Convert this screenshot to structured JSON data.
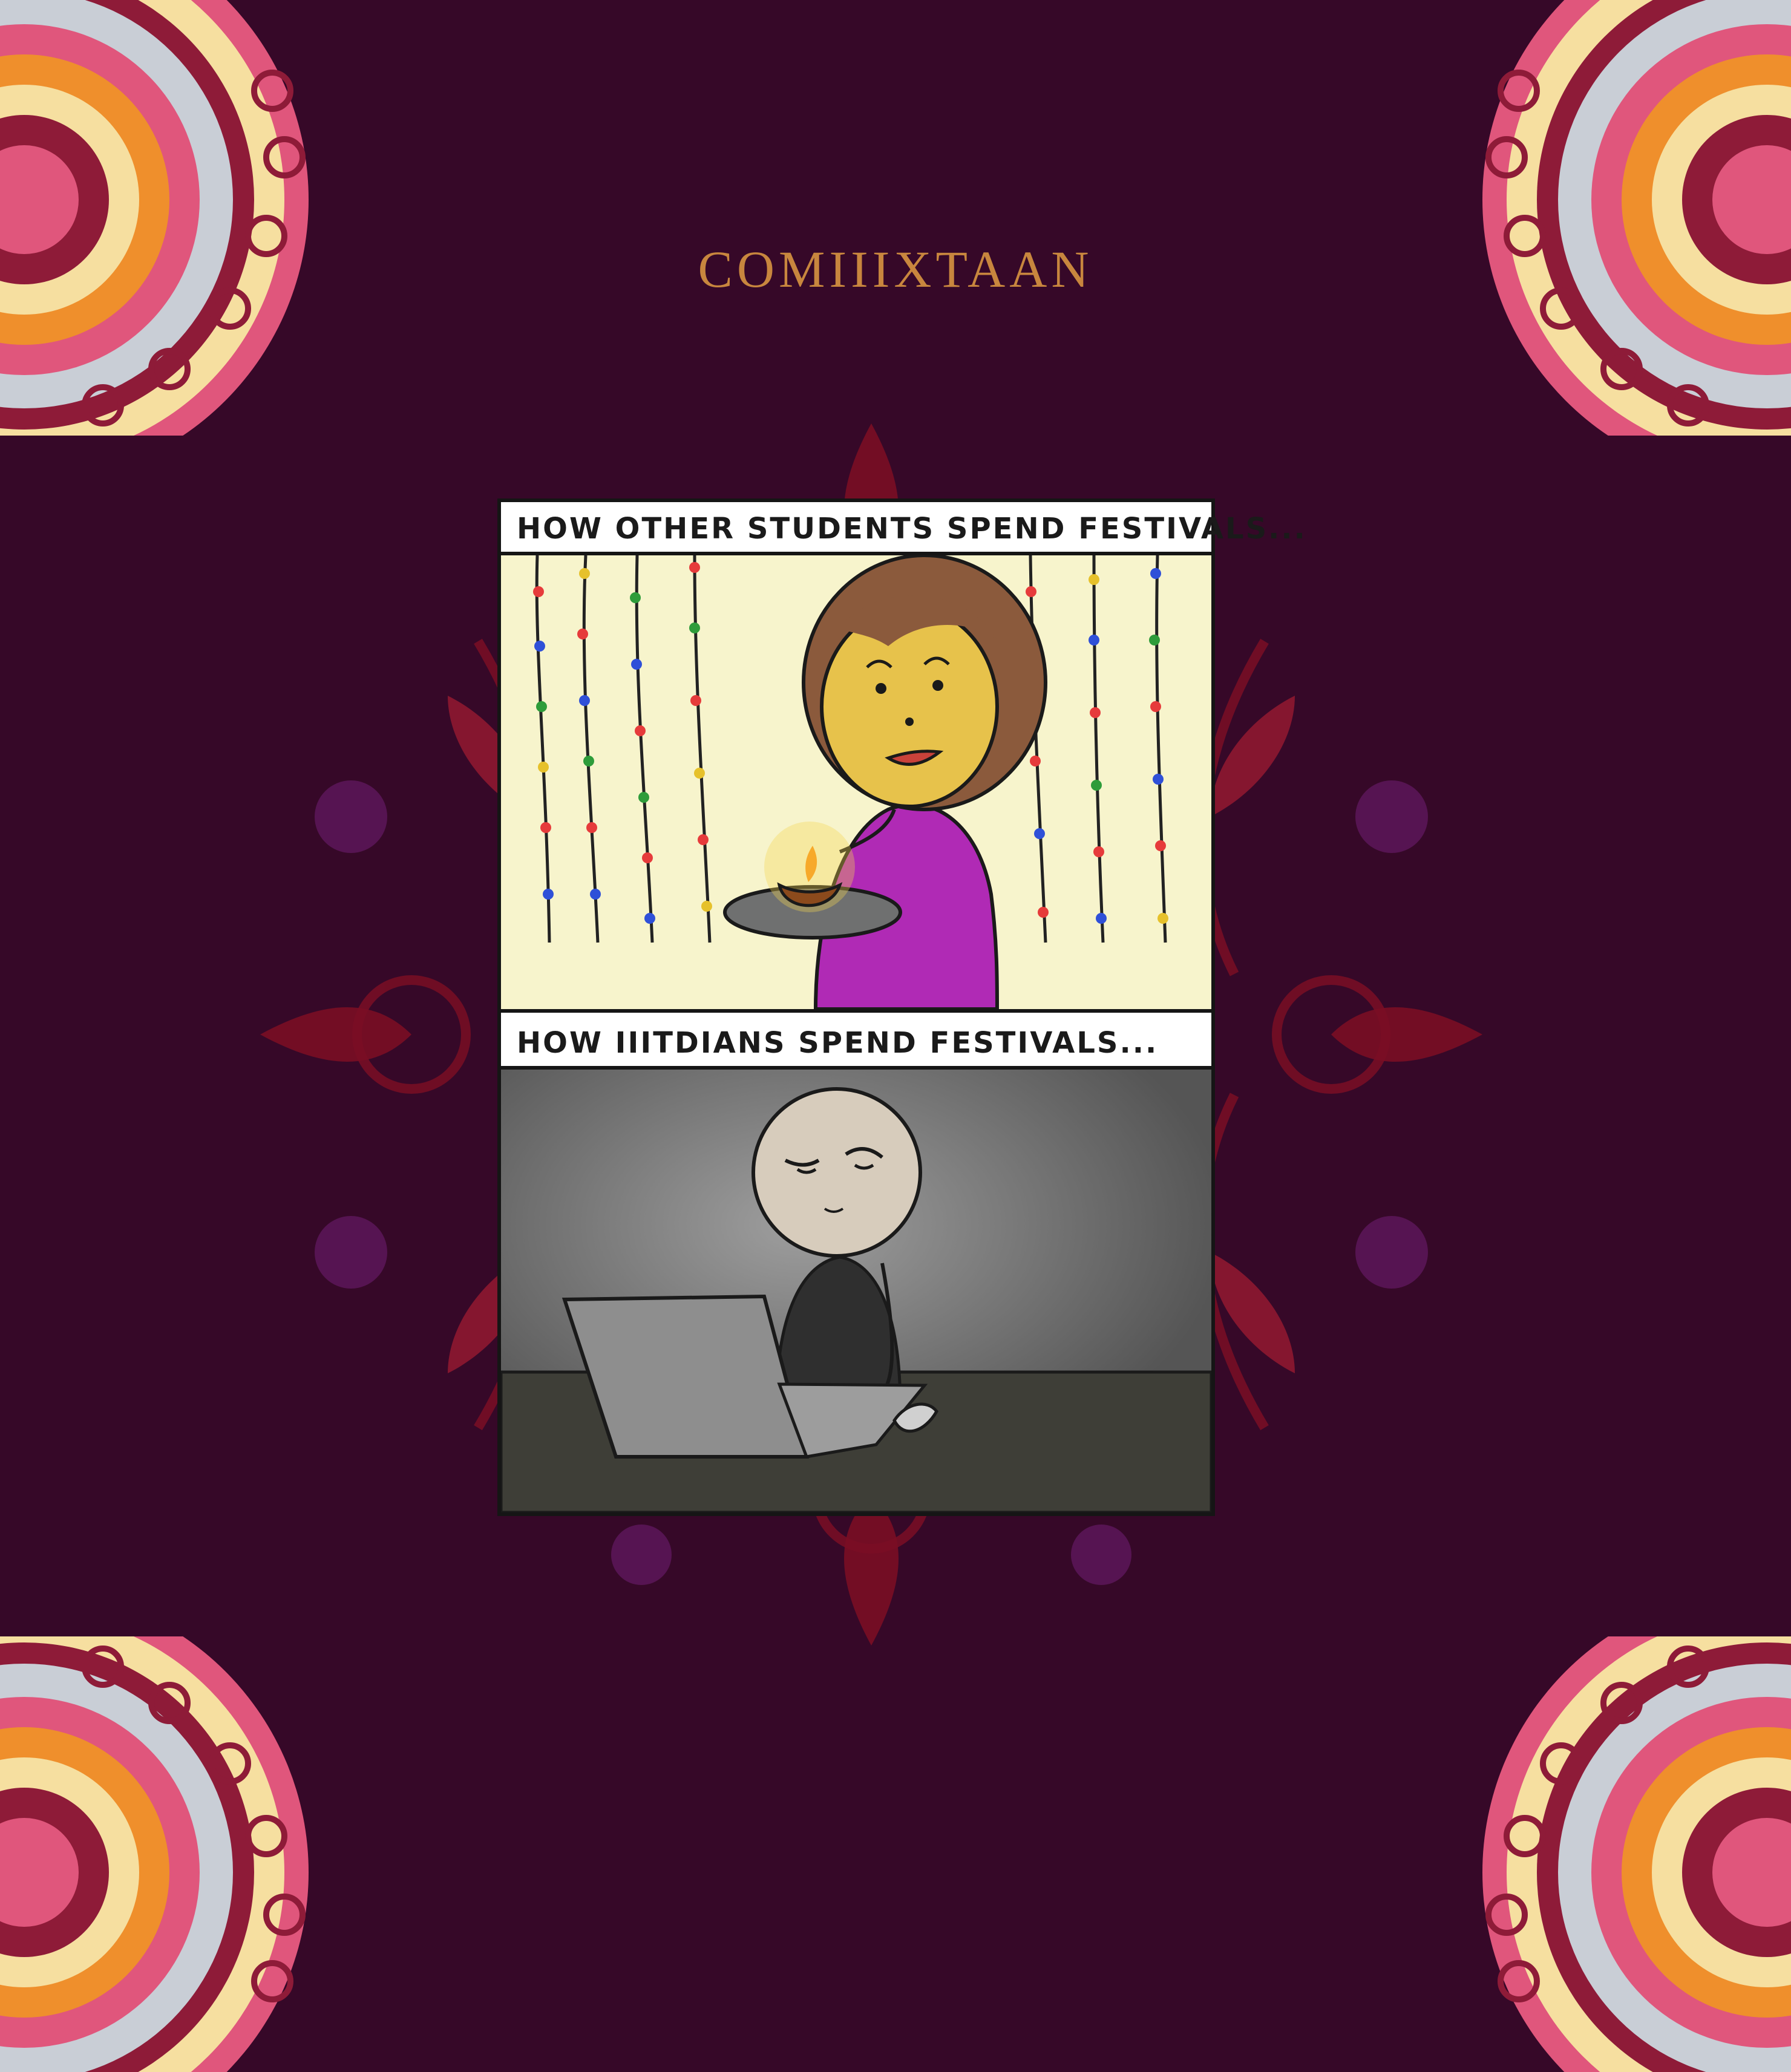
{
  "page": {
    "title": "COMIIIXTAAN",
    "background_color": "#360828",
    "title_color": "#C8863E"
  },
  "comic": {
    "panels": [
      {
        "caption": "HOW OTHER STUDENTS SPEND FESTIVALS...",
        "scene": "girl-with-diya",
        "background_color": "#F7F4CC"
      },
      {
        "caption": "HOW IIITDIANS SPEND FESTIVALS...",
        "scene": "student-at-laptop",
        "background_color": "#5B5B5B"
      }
    ]
  },
  "decorations": {
    "corner_ornaments": [
      "mandala-top-left",
      "mandala-top-right",
      "mandala-bottom-left",
      "mandala-bottom-right"
    ],
    "center_ornament": "rangoli-motif",
    "colors": {
      "cream": "#F6DFA0",
      "pink": "#E0567C",
      "maroon": "#8E1B38",
      "grey": "#C9CED6",
      "red": "#A8102A",
      "orange": "#EF8F2C"
    }
  }
}
